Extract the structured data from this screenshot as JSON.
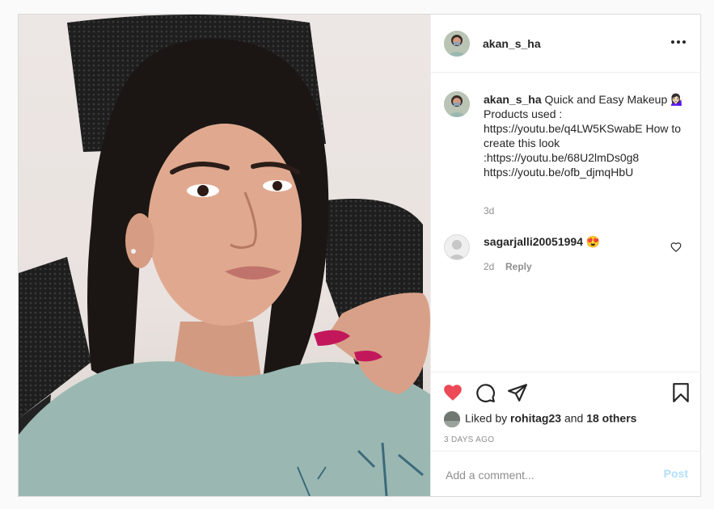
{
  "post": {
    "username": "akan_s_ha",
    "image_alt": "Selfie of a woman in a light green t-shirt sitting on a black office chair",
    "caption": {
      "username": "akan_s_ha",
      "text": "Quick and Easy Makeup 💁🏻‍♀️ Products used : https://youtu.be/q4LW5KSwabE How to create this look :https://youtu.be/68U2lmDs0g8 https://youtu.be/ofb_djmqHbU",
      "age": "3d"
    },
    "comments": [
      {
        "username": "sagarjalli20051994",
        "text": "😍",
        "age": "2d",
        "reply_label": "Reply"
      }
    ],
    "likes": {
      "prefix": "Liked by",
      "user": "rohitag23",
      "joiner": "and",
      "others": "18 others"
    },
    "time_ago": "3 DAYS AGO",
    "add_comment": {
      "placeholder": "Add a comment...",
      "post_label": "Post"
    }
  },
  "icons": {
    "more": "more-horizontal-icon",
    "like": "heart-filled-icon",
    "comment": "comment-icon",
    "share": "paper-plane-icon",
    "save": "bookmark-icon",
    "comment_like": "heart-outline-icon"
  },
  "colors": {
    "like_red": "#ed4956",
    "post_disabled_blue": "#b2dffc",
    "meta_gray": "#8e8e8e",
    "border": "#dbdbdb"
  }
}
